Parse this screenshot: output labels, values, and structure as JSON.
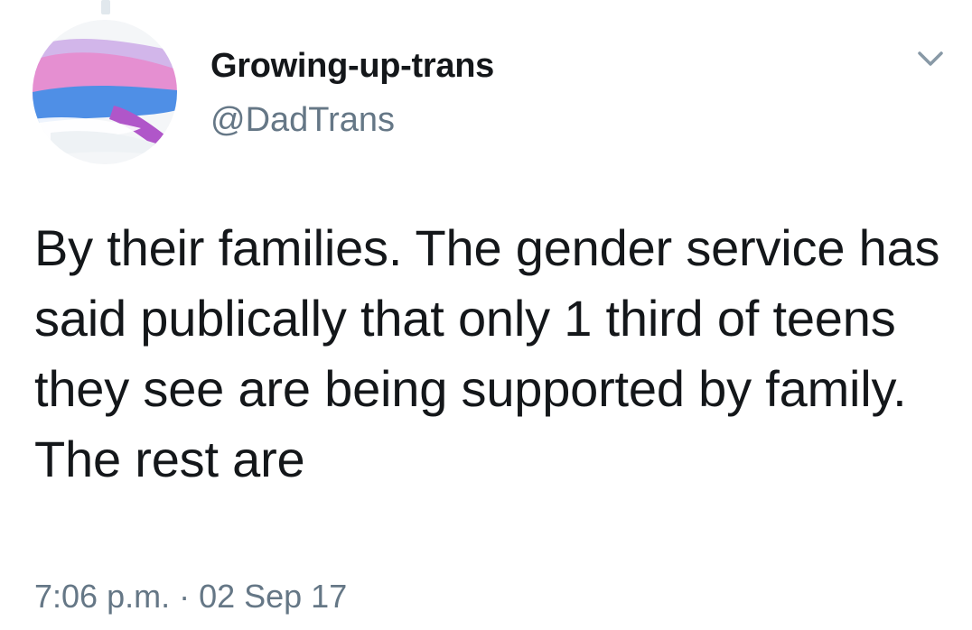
{
  "tweet": {
    "display_name": "Growing-up-trans",
    "handle": "@DadTrans",
    "text": "By their families. The gender service has said publically that only 1 third of teens they see are being supported by family. The rest are",
    "timestamp": "7:06 p.m. · 02 Sep 17"
  },
  "icons": {
    "avatar": "trans-flag-avatar",
    "caret": "chevron-down-icon"
  },
  "colors": {
    "text": "#14171a",
    "secondary": "#657786",
    "flag_blue": "#5bcefa",
    "flag_pink": "#f5a9b8",
    "flag_purple": "#a85fc0"
  }
}
